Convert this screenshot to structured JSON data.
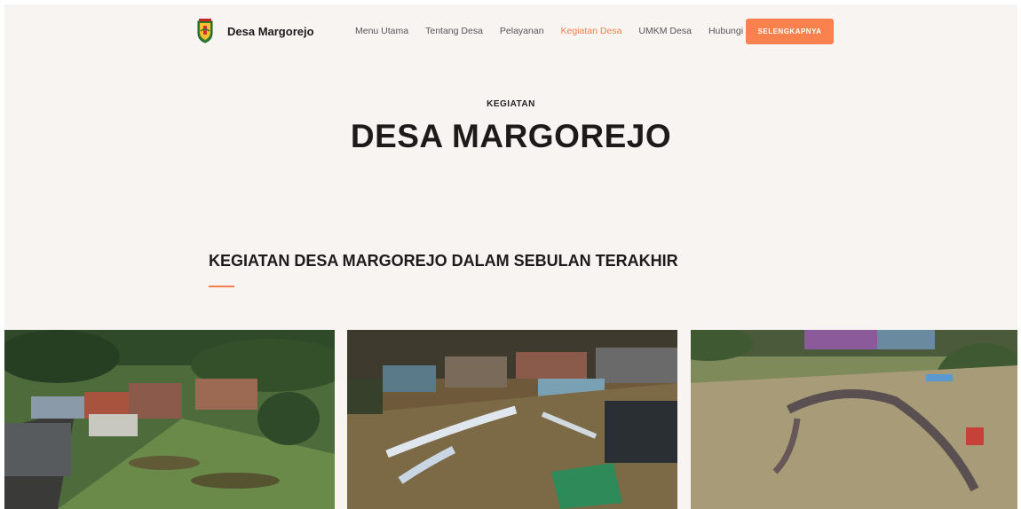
{
  "header": {
    "brand": "Desa Margorejo",
    "nav": [
      {
        "label": "Menu Utama",
        "active": false
      },
      {
        "label": "Tentang Desa",
        "active": false
      },
      {
        "label": "Pelayanan",
        "active": false
      },
      {
        "label": "Kegiatan Desa",
        "active": true
      },
      {
        "label": "UMKM Desa",
        "active": false
      },
      {
        "label": "Hubungi",
        "active": false
      }
    ],
    "cta_label": "SELENGKAPNYA"
  },
  "hero": {
    "eyebrow": "KEGIATAN",
    "title": "DESA MARGOREJO"
  },
  "section": {
    "title": "KEGIATAN DESA MARGOREJO DALAM SEBULAN TERAKHIR"
  },
  "gallery": {
    "photos": [
      "aerial-photo",
      "aerial-photo",
      "aerial-photo"
    ]
  },
  "colors": {
    "accent": "#f47f4a",
    "button": "#f9814d",
    "background": "#f8f4f2",
    "text": "#1e1a1a"
  }
}
